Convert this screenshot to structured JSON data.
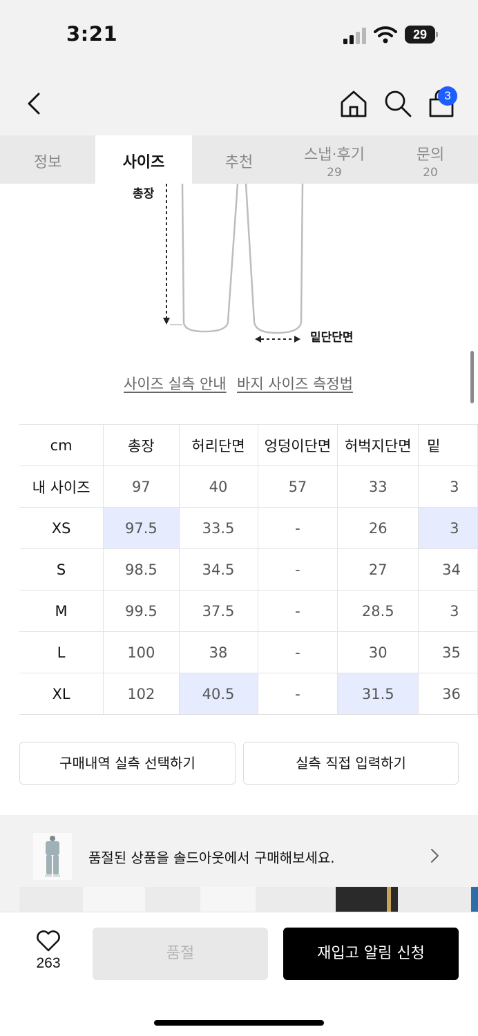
{
  "status": {
    "time": "3:21",
    "battery": "29"
  },
  "nav": {
    "cart_count": "3"
  },
  "tabs": [
    {
      "label": "정보",
      "count": ""
    },
    {
      "label": "사이즈",
      "count": ""
    },
    {
      "label": "추천",
      "count": ""
    },
    {
      "label": "스냅·후기",
      "count": "29"
    },
    {
      "label": "문의",
      "count": "20"
    }
  ],
  "illustration": {
    "length_label": "총장",
    "hem_label": "밑단단면"
  },
  "links": {
    "size_guide": "사이즈 실측 안내",
    "measure_guide": "바지 사이즈 측정법"
  },
  "table": {
    "headers": [
      "cm",
      "총장",
      "허리단면",
      "엉덩이단면",
      "허벅지단면",
      "밑"
    ],
    "rows": [
      {
        "label": "내 사이즈",
        "cells": [
          "97",
          "40",
          "57",
          "33",
          "3"
        ]
      },
      {
        "label": "XS",
        "cells": [
          "97.5",
          "33.5",
          "-",
          "26",
          "3"
        ]
      },
      {
        "label": "S",
        "cells": [
          "98.5",
          "34.5",
          "-",
          "27",
          "34"
        ]
      },
      {
        "label": "M",
        "cells": [
          "99.5",
          "37.5",
          "-",
          "28.5",
          "3"
        ]
      },
      {
        "label": "L",
        "cells": [
          "100",
          "38",
          "-",
          "30",
          "35"
        ]
      },
      {
        "label": "XL",
        "cells": [
          "102",
          "40.5",
          "-",
          "31.5",
          "36"
        ]
      }
    ]
  },
  "actions": {
    "purchase_history": "구매내역 실측 선택하기",
    "manual_input": "실측 직접 입력하기"
  },
  "soldout_banner": {
    "text": "품절된 상품을 솔드아웃에서 구매해보세요."
  },
  "bottom": {
    "like_count": "263",
    "soldout_label": "품절",
    "restock_label": "재입고 알림 신청"
  },
  "colors": {
    "highlight": "#e6ecfd",
    "badge": "#1e5eff",
    "primary_button": "#000000"
  }
}
